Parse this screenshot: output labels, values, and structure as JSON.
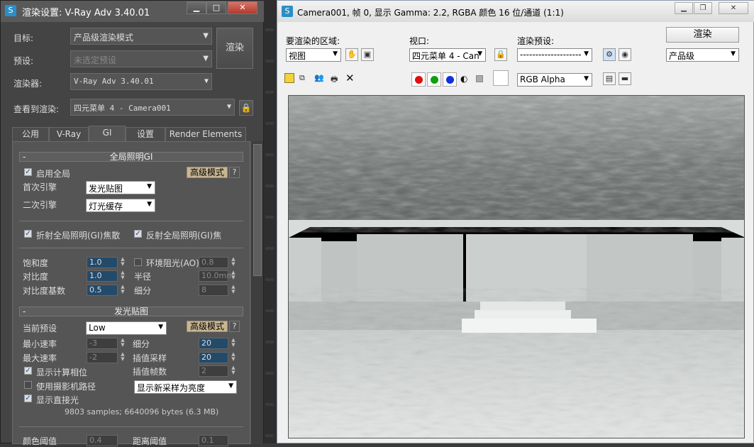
{
  "left_window": {
    "title": "渲染设置: V-Ray Adv 3.40.01",
    "title_buttons": {
      "minimize": "▭",
      "restore": "▭",
      "close": "✕"
    },
    "target_label": "目标:",
    "target_value": "产品级渲染模式",
    "preset_label": "预设:",
    "preset_value": "未选定预设",
    "renderer_label": "渲染器:",
    "renderer_value": "V-Ray Adv 3.40.01",
    "view_label": "查看到渲染:",
    "view_value": "四元菜单 4 - Camera001",
    "render_button": "渲染",
    "tabs": [
      "公用",
      "V-Ray",
      "GI",
      "设置",
      "Render Elements"
    ],
    "gi_rollout": {
      "header": "全局照明GI",
      "enable_label": "启用全局",
      "enable_checked": true,
      "advanced_mode": "高级模式",
      "help": "?",
      "primary_label": "首次引擎",
      "primary_value": "发光贴图",
      "secondary_label": "二次引擎",
      "secondary_value": "灯光缓存",
      "refractive_label": "折射全局照明(GI)焦散",
      "reflective_label": "反射全局照明(GI)焦",
      "saturation_label": "饱和度",
      "saturation_value": "1.0",
      "contrast_label": "对比度",
      "contrast_value": "1.0",
      "contrast_base_label": "对比度基数",
      "contrast_base_value": "0.5",
      "ao_label": "环境阻光(AO)",
      "ao_value": "0.8",
      "radius_label": "半径",
      "radius_value": "10.0mm",
      "subdivs_label": "细分",
      "subdivs_value": "8"
    },
    "irradiance_rollout": {
      "header": "发光贴图",
      "preset_label": "当前预设",
      "preset_value": "Low",
      "advanced_mode": "高级模式",
      "help": "?",
      "min_rate_label": "最小速率",
      "min_rate_value": "-3",
      "max_rate_label": "最大速率",
      "max_rate_value": "-2",
      "subdivs_label": "细分",
      "subdivs_value": "20",
      "interp_label": "插值采样",
      "interp_value": "20",
      "interp_frames_label": "插值帧数",
      "interp_frames_value": "2",
      "show_calc_label": "显示计算相位",
      "use_camera_label": "使用摄影机路径",
      "show_direct_label": "显示直接光",
      "show_mode_value": "显示新采样为亮度",
      "stats": "9803 samples; 6640096 bytes (6.3 MB)",
      "color_thresh_label": "颜色阈值",
      "color_thresh_value": "0.4",
      "dist_thresh_label": "距离阈值",
      "dist_thresh_value": "0.1"
    }
  },
  "right_window": {
    "title": "Camera001, 帧 0, 显示 Gamma: 2.2, RGBA 颜色 16 位/通道 (1:1)",
    "area_label": "要渲染的区域:",
    "area_value": "视图",
    "viewport_label": "视口:",
    "viewport_value": "四元菜单 4 - Can",
    "preset_label": "渲染预设:",
    "preset_value": "--------------------",
    "render_button": "渲染",
    "quality_value": "产品级",
    "channel_value": "RGB Alpha",
    "colors": {
      "red": "#e01010",
      "green": "#10a010",
      "blue": "#1030e0"
    }
  },
  "render_image": {
    "description_free": ""
  }
}
